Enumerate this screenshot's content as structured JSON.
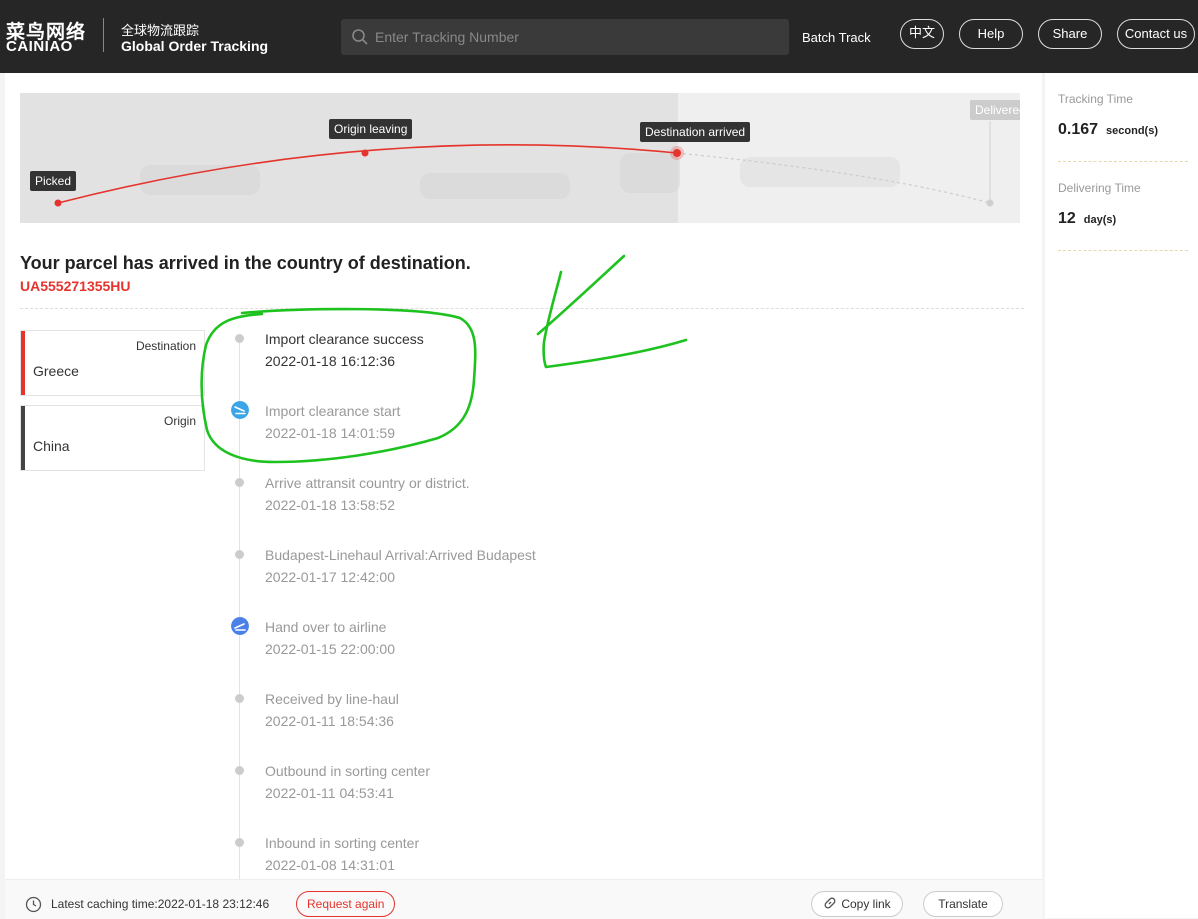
{
  "header": {
    "logo_cn": "菜鸟网络",
    "logo_en": "CAINIAO",
    "subtitle_cn": "全球物流跟踪",
    "subtitle_en": "Global Order Tracking",
    "search_placeholder": "Enter Tracking Number",
    "batch_track": "Batch Track",
    "lang": "中文",
    "help": "Help",
    "share": "Share",
    "contact": "Contact us"
  },
  "route": {
    "picked": "Picked",
    "origin_leaving": "Origin leaving",
    "destination_arrived": "Destination arrived",
    "delivered": "Delivered"
  },
  "status": {
    "title": "Your parcel has arrived in the country of destination.",
    "tracking_number": "UA555271355HU"
  },
  "cards": [
    {
      "key": "Destination",
      "value": "Greece",
      "color": "#e4342d"
    },
    {
      "key": "Origin",
      "value": "China",
      "color": "#444444"
    }
  ],
  "events": [
    {
      "title": "Import clearance success",
      "time": "2022-01-18 16:12:36",
      "icon": "dot"
    },
    {
      "title": "Import clearance start",
      "time": "2022-01-18 14:01:59",
      "icon": "plane-landing-icon"
    },
    {
      "title": "Arrive attransit country or district.",
      "time": "2022-01-18 13:58:52",
      "icon": "dot"
    },
    {
      "title": "Budapest-Linehaul Arrival:Arrived Budapest",
      "time": "2022-01-17 12:42:00",
      "icon": "dot"
    },
    {
      "title": "Hand over to airline",
      "time": "2022-01-15 22:00:00",
      "icon": "plane-takeoff-icon"
    },
    {
      "title": "Received by line-haul",
      "time": "2022-01-11 18:54:36",
      "icon": "dot"
    },
    {
      "title": "Outbound in sorting center",
      "time": "2022-01-11 04:53:41",
      "icon": "dot"
    },
    {
      "title": "Inbound in sorting center",
      "time": "2022-01-08 14:31:01",
      "icon": "dot"
    }
  ],
  "sidebar": {
    "tracking_time_label": "Tracking Time",
    "tracking_time_value": "0.167",
    "tracking_time_unit": "second(s)",
    "delivering_time_label": "Delivering Time",
    "delivering_time_value": "12",
    "delivering_time_unit": "day(s)"
  },
  "footer": {
    "cache": "Latest caching time:2022-01-18 23:12:46",
    "request_again": "Request again",
    "copy_link": "Copy link",
    "translate": "Translate"
  },
  "colors": {
    "accent": "#e4342d",
    "header_bg": "#262626",
    "annotation": "#1ec21e"
  }
}
